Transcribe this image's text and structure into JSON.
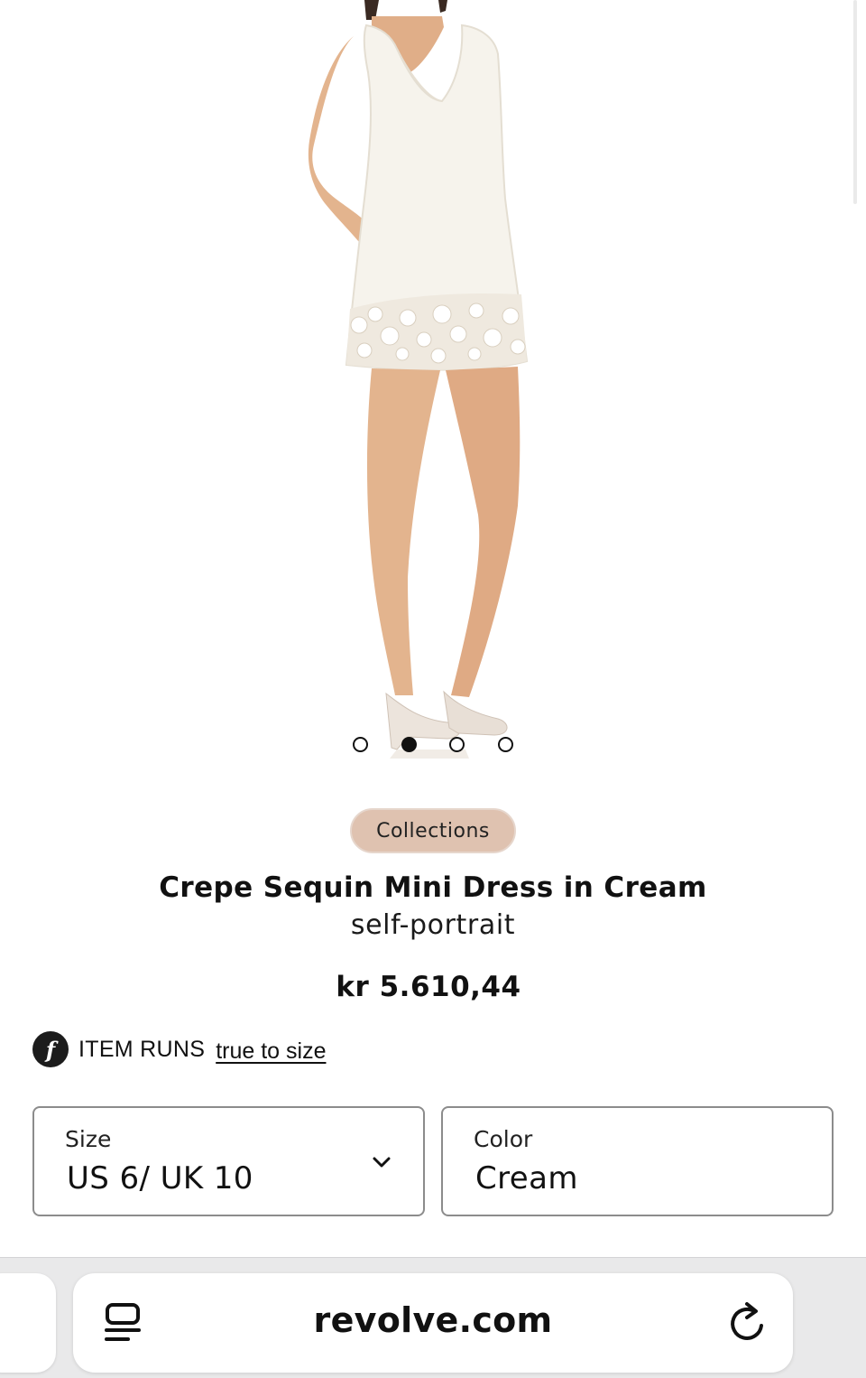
{
  "product_image": {
    "icon": "dress-photo",
    "carousel": {
      "count": 4,
      "active_index": 1
    }
  },
  "product": {
    "badge": "Collections",
    "title": "Crepe Sequin Mini Dress in Cream",
    "brand": "self-portrait",
    "price": "kr 5.610,44"
  },
  "fit": {
    "logo_icon": "fit-predictor-logo-icon",
    "logo_glyph": "f",
    "label": "ITEM RUNS",
    "link": "true to size"
  },
  "size_select": {
    "label": "Size",
    "value": "US 6/ UK 10",
    "icon": "chevron-down-icon"
  },
  "color_select": {
    "label": "Color",
    "value": "Cream"
  },
  "browser": {
    "url": "revolve.com",
    "left_icon": "reader-icon",
    "right_icon": "reload-icon"
  },
  "colors": {
    "badge_bg": "#dfc2b0",
    "dress": "#f6f3ec",
    "skin": "#e3b48e"
  }
}
